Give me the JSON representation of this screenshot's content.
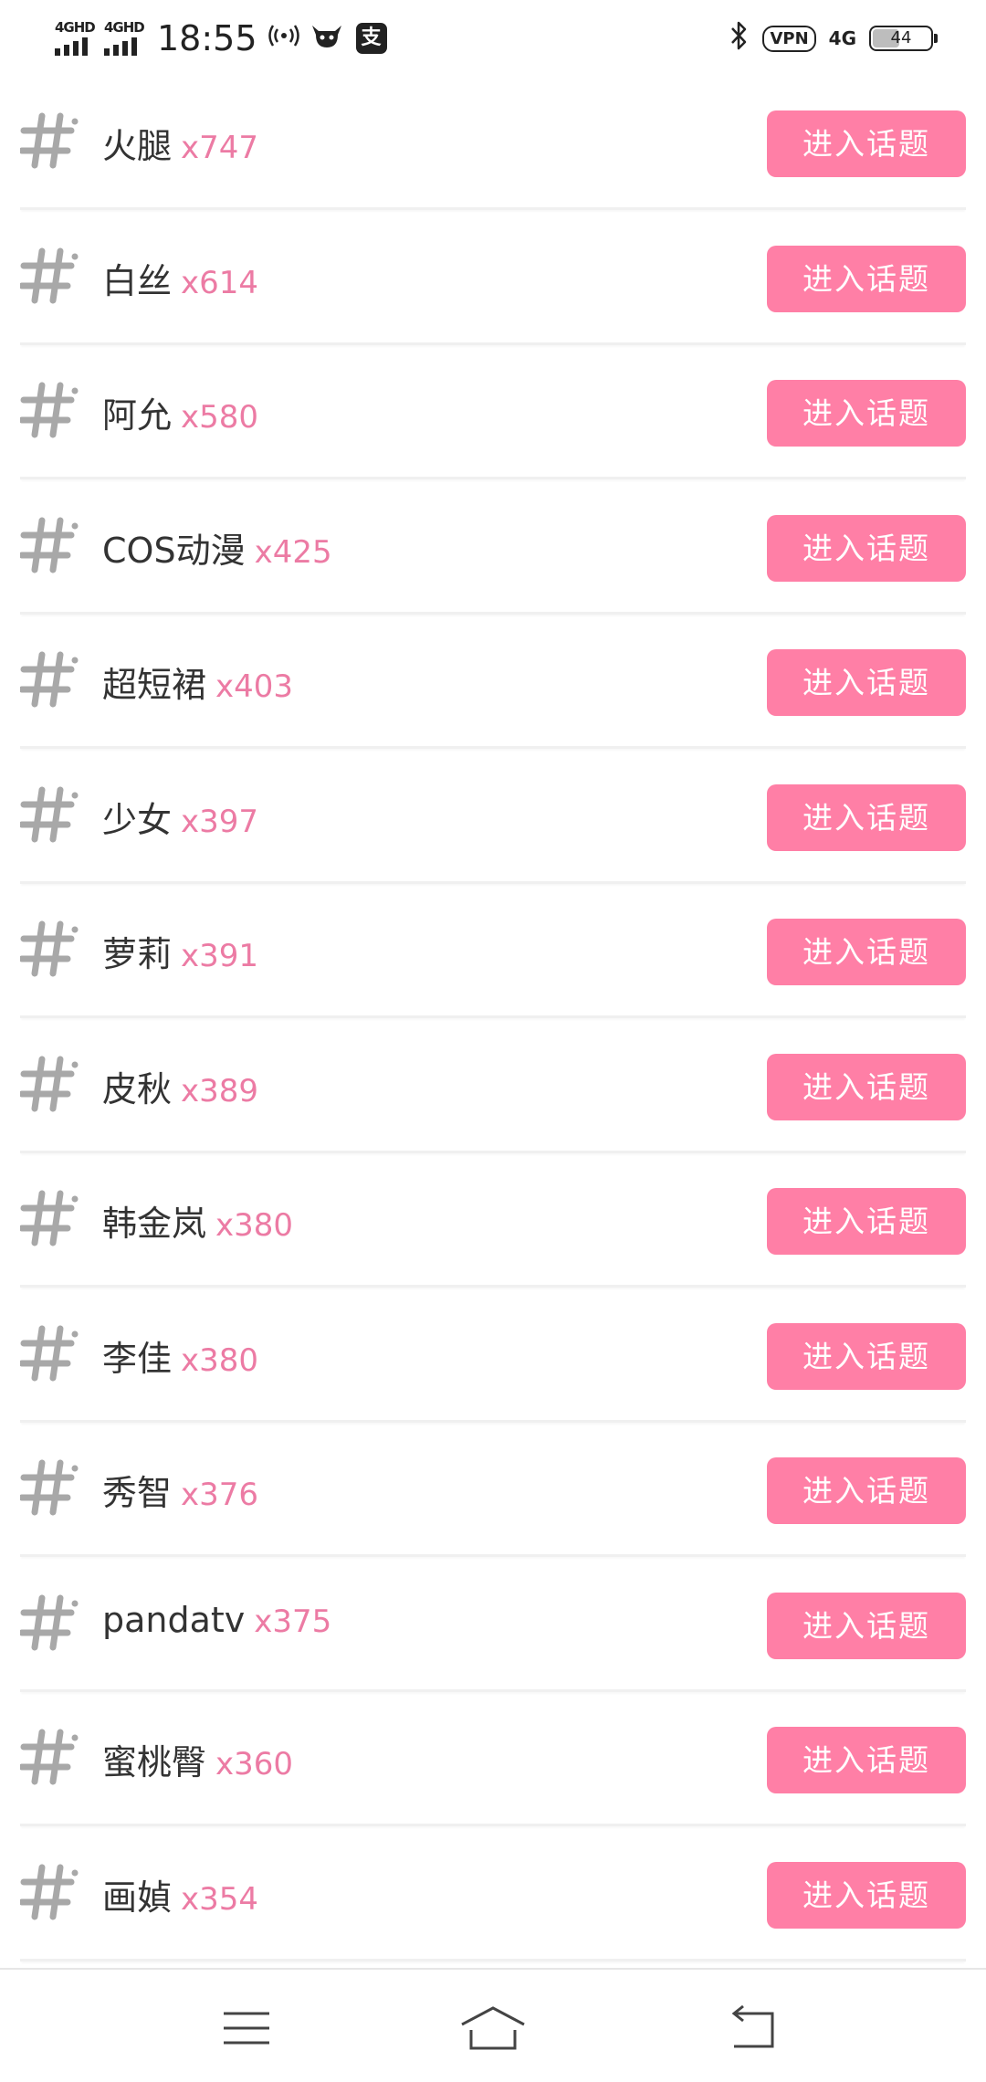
{
  "status_bar": {
    "signal1": "4GHD",
    "signal2": "4GHD",
    "time": "18:55",
    "icons": [
      "hotspot-icon",
      "bull-icon",
      "alipay-icon"
    ],
    "alipay_glyph": "支",
    "right_icons": [
      "bluetooth-icon",
      "vpn-icon",
      "4g-icon",
      "battery-icon"
    ],
    "vpn_label": "VPN",
    "net_label": "4G",
    "battery_level": "44"
  },
  "topics": [
    {
      "name": "火腿",
      "count": "x747"
    },
    {
      "name": "白丝",
      "count": "x614"
    },
    {
      "name": "阿允",
      "count": "x580"
    },
    {
      "name": "COS动漫",
      "count": "x425"
    },
    {
      "name": "超短裙",
      "count": "x403"
    },
    {
      "name": "少女",
      "count": "x397"
    },
    {
      "name": "萝莉",
      "count": "x391"
    },
    {
      "name": "皮秋",
      "count": "x389"
    },
    {
      "name": "韩金岚",
      "count": "x380"
    },
    {
      "name": "李佳",
      "count": "x380"
    },
    {
      "name": "秀智",
      "count": "x376"
    },
    {
      "name": "pandatv",
      "count": "x375"
    },
    {
      "name": "蜜桃臀",
      "count": "x360"
    },
    {
      "name": "画媜",
      "count": "x354"
    }
  ],
  "enter_button_label": "进入话题",
  "colors": {
    "accent": "#ff7fa6",
    "count": "#ec7ba4",
    "hash": "#a8a8a8"
  },
  "nav_bar": [
    "menu-icon",
    "home-icon",
    "back-icon"
  ]
}
